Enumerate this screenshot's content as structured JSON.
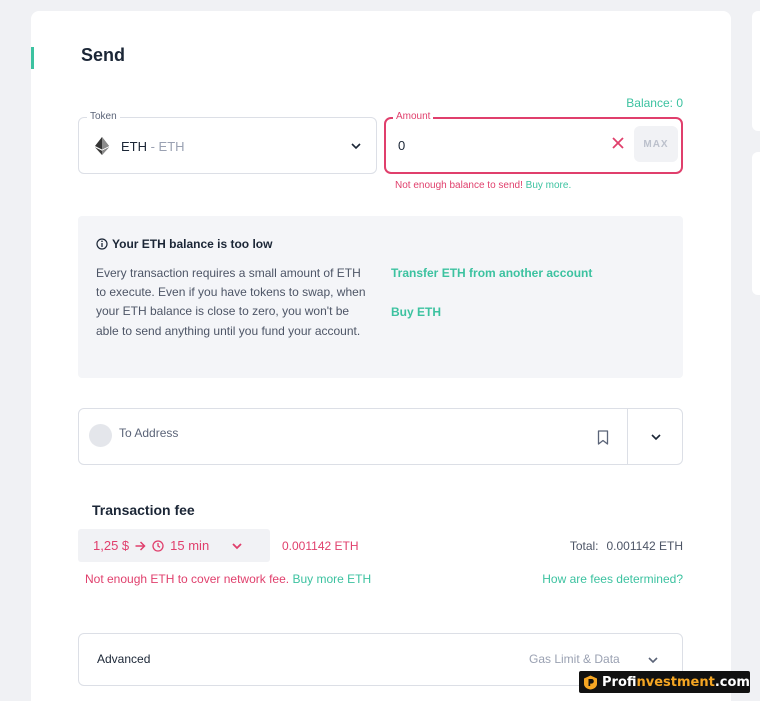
{
  "page": {
    "title": "Send"
  },
  "token": {
    "label": "Token",
    "symbol": "ETH",
    "subtitle": " - ETH",
    "icon": "ethereum-icon"
  },
  "amount": {
    "label": "Amount",
    "value": "0",
    "balance": "Balance: 0",
    "max_label": "MAX",
    "error_text": "Not enough balance to send! ",
    "error_link": "Buy more."
  },
  "warning": {
    "title": "Your ETH balance is too low",
    "body": "Every transaction requires a small amount of ETH to execute. Even if you have tokens to swap, when your ETH balance is close to zero, you won't be able to send anything until you fund your account.",
    "link_transfer": "Transfer ETH from another account",
    "link_buy": "Buy ETH"
  },
  "address": {
    "placeholder": "To Address"
  },
  "fee": {
    "title": "Transaction fee",
    "price": "1,25 $",
    "time": "15 min",
    "eth_amount": "0.001142 ETH",
    "total_label": "Total:",
    "total_value": "0.001142 ETH",
    "error_text": "Not enough ETH to cover network fee. ",
    "error_link": "Buy more ETH",
    "help_link": "How are fees determined?"
  },
  "advanced": {
    "label": "Advanced",
    "right_text": "Gas Limit & Data"
  },
  "watermark": {
    "prefix": "Prof",
    "highlight": "investment",
    "suffix": ".com"
  },
  "colors": {
    "accent": "#3cc2a0",
    "error": "#e03f6c",
    "text": "#1b2636",
    "muted": "#9aa1b2"
  }
}
